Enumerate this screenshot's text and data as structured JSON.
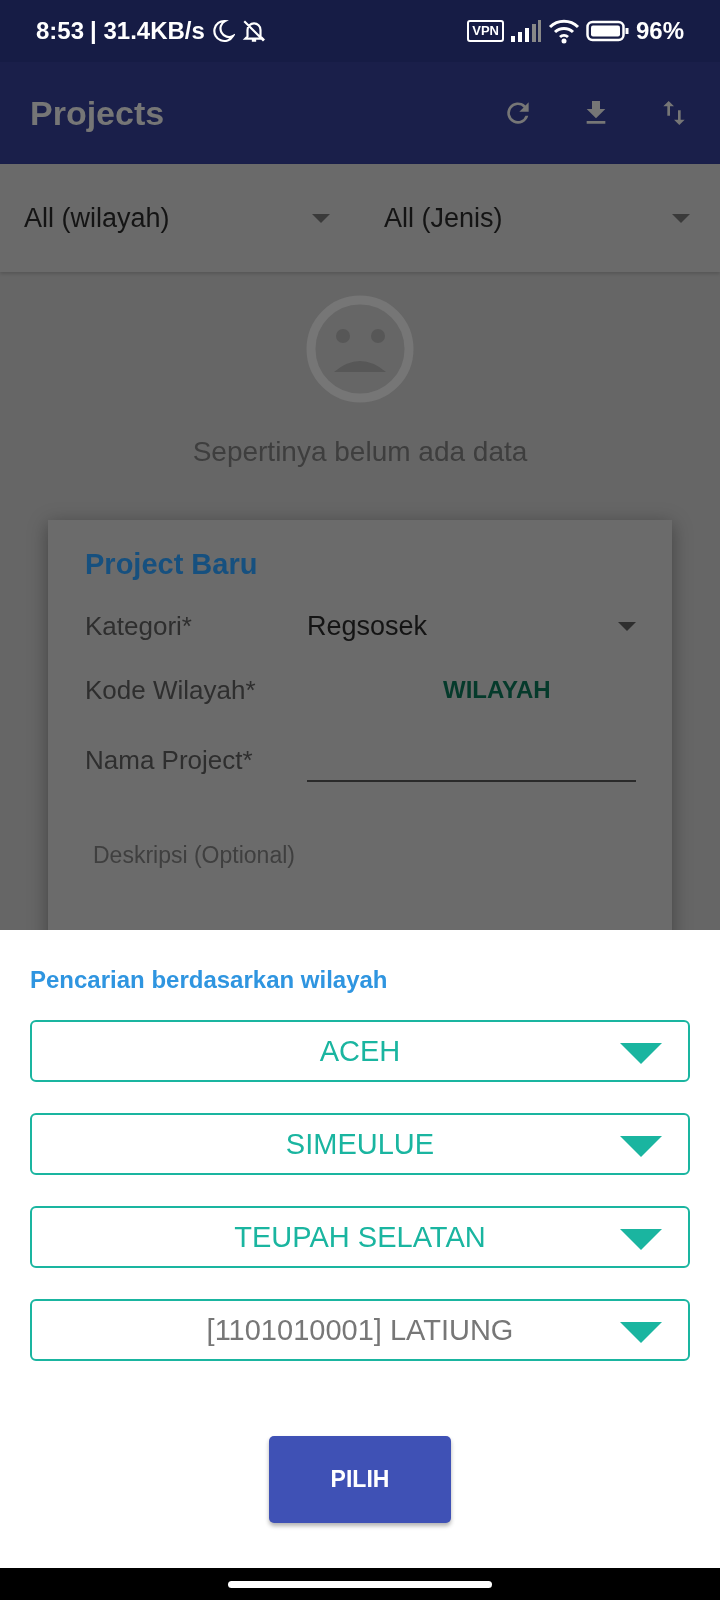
{
  "status_bar": {
    "time": "8:53",
    "network_speed": "| 31.4KB/s",
    "vpn": "VPN",
    "battery": "96%"
  },
  "app_bar": {
    "title": "Projects"
  },
  "filters": [
    {
      "label": "All (wilayah)"
    },
    {
      "label": "All (Jenis)"
    }
  ],
  "empty_state": {
    "message": "Sepertinya belum ada data"
  },
  "dialog": {
    "title": "Project Baru",
    "fields": [
      {
        "kind": "dropdown",
        "label": "Kategori*",
        "value": "Regsosek"
      },
      {
        "kind": "button",
        "label": "Kode Wilayah*",
        "value": "WILAYAH"
      },
      {
        "kind": "input",
        "label": "Nama Project*"
      },
      {
        "kind": "textarea",
        "placeholder": "Deskripsi (Optional)"
      }
    ]
  },
  "region_sheet": {
    "title": "Pencarian berdasarkan wilayah",
    "dropdowns": [
      {
        "value": "ACEH",
        "muted": false
      },
      {
        "value": "SIMEULUE",
        "muted": false
      },
      {
        "value": "TEUPAH SELATAN",
        "muted": false
      },
      {
        "value": "[1101010001]  LATIUNG",
        "muted": true
      }
    ],
    "button": "PILIH"
  }
}
